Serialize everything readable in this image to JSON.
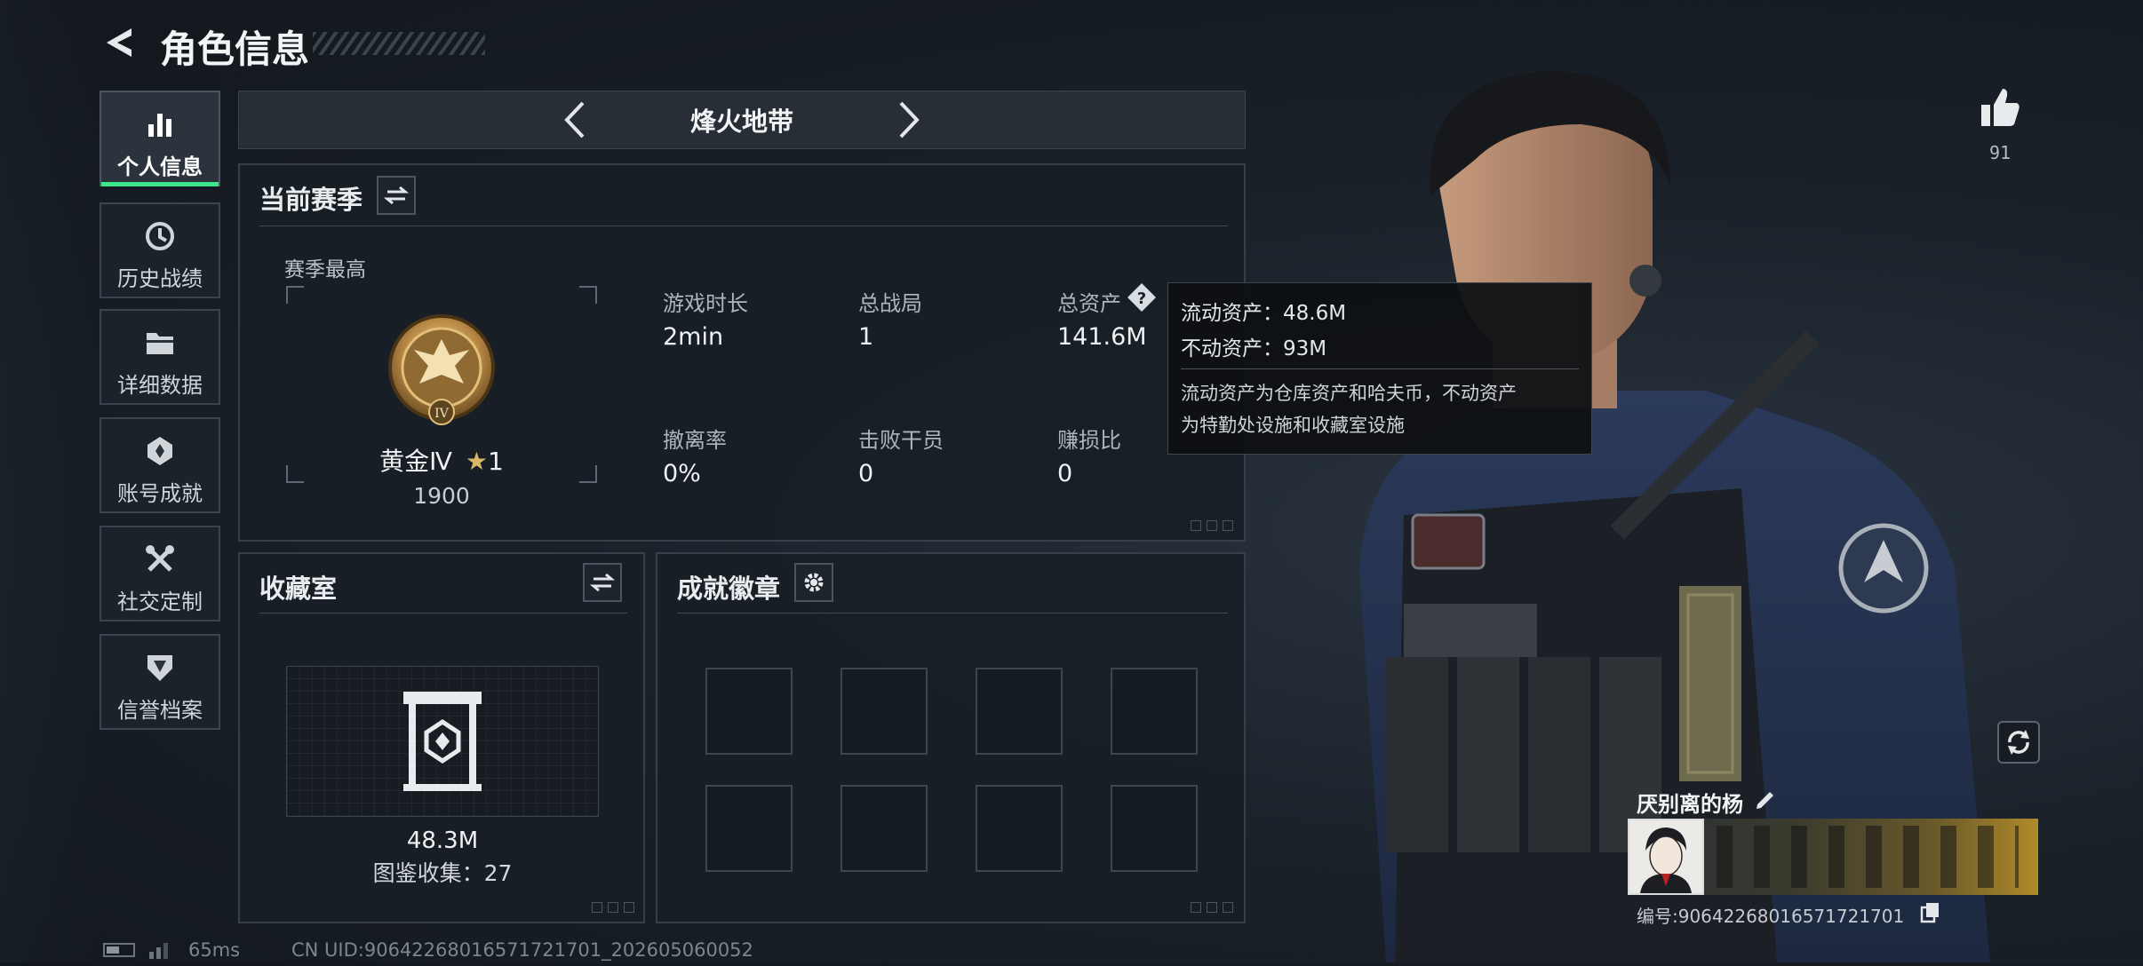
{
  "header": {
    "title": "角色信息"
  },
  "sidebar": {
    "items": [
      {
        "label": "个人信息",
        "icon": "bar-chart-icon",
        "active": true
      },
      {
        "label": "历史战绩",
        "icon": "history-icon",
        "active": false
      },
      {
        "label": "详细数据",
        "icon": "folder-icon",
        "active": false
      },
      {
        "label": "账号成就",
        "icon": "achievement-icon",
        "active": false
      },
      {
        "label": "社交定制",
        "icon": "tools-icon",
        "active": false
      },
      {
        "label": "信誉档案",
        "icon": "shield-badge-icon",
        "active": false
      }
    ]
  },
  "mode_selector": {
    "label": "烽火地带"
  },
  "season": {
    "title": "当前赛季",
    "best_label": "赛季最高",
    "rank_name": "黄金Ⅳ",
    "rank_stars": "1",
    "rank_score": "1900",
    "stats": [
      {
        "label": "游戏时长",
        "value": "2min"
      },
      {
        "label": "总战局",
        "value": "1"
      },
      {
        "label": "总资产",
        "value": "141.6M"
      },
      {
        "label": "撤离率",
        "value": "0%"
      },
      {
        "label": "击败干员",
        "value": "0"
      },
      {
        "label": "赚损比",
        "value": "0"
      }
    ]
  },
  "tooltip": {
    "liquid": "流动资产：48.6M",
    "fixed": "不动资产：93M",
    "desc_line1": "流动资产为仓库资产和哈夫币，不动资产",
    "desc_line2": "为特勤处设施和收藏室设施"
  },
  "collection": {
    "title": "收藏室",
    "value": "48.3M",
    "catalog": "图鉴收集：27"
  },
  "badges": {
    "title": "成就徽章"
  },
  "likes": {
    "count": "91"
  },
  "player": {
    "name": "厌别离的杨",
    "id": "编号:906422680165717217​01"
  },
  "footer": {
    "ping": "65ms",
    "uid": "CN UID:906422680165717217​01_202605060052"
  },
  "colors": {
    "accent": "#3ee58a",
    "panel": "#181e25",
    "border": "#36404a"
  }
}
